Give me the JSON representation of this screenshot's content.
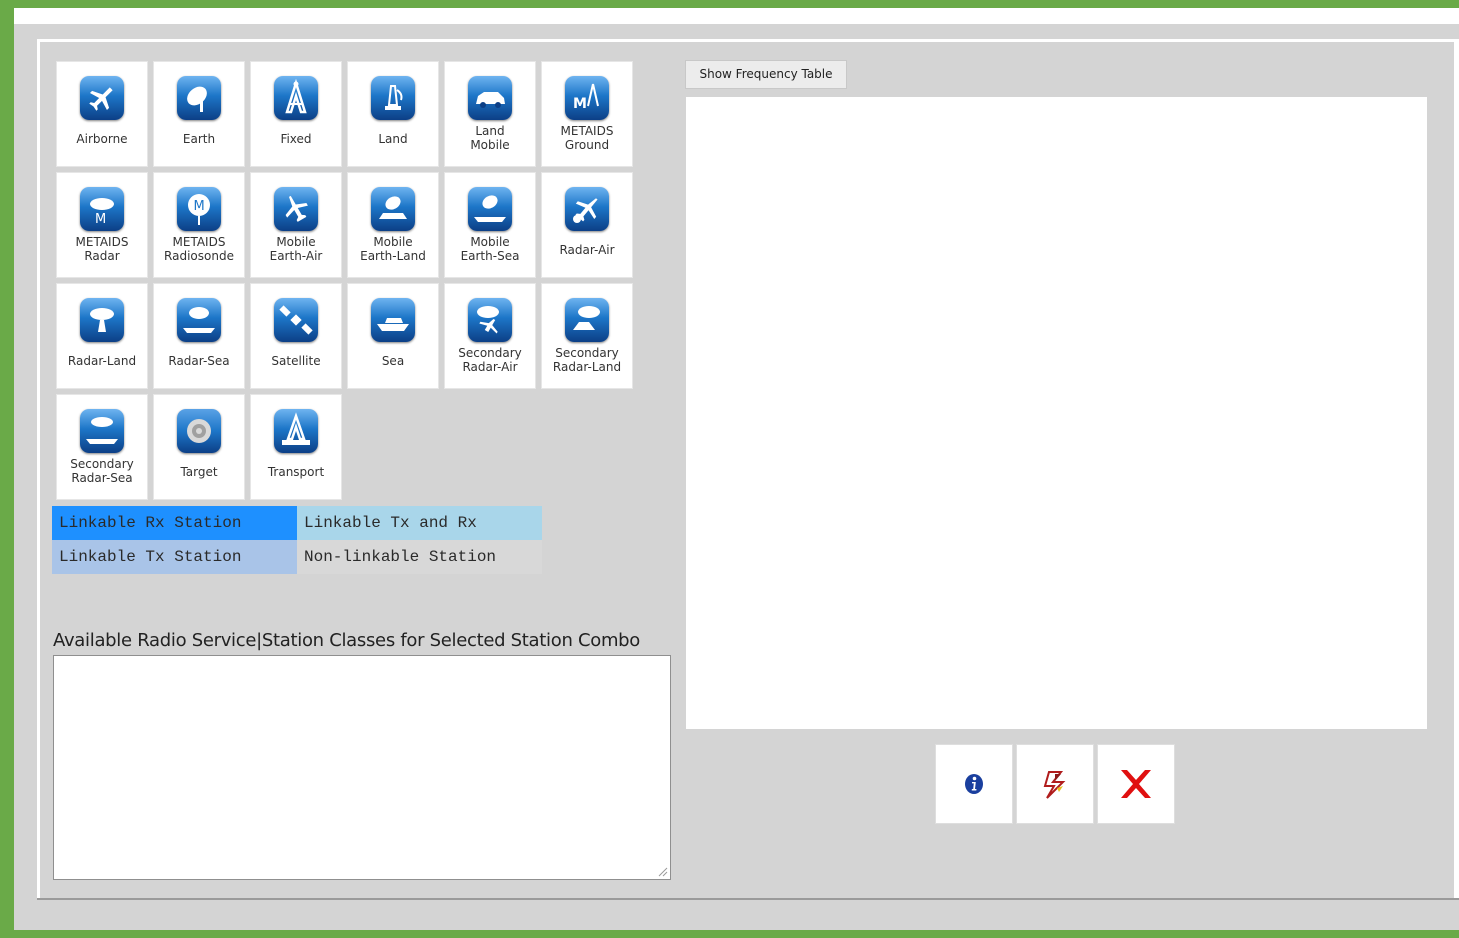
{
  "stations": [
    {
      "label": "Airborne",
      "icon": "airplane-icon"
    },
    {
      "label": "Earth",
      "icon": "satellite-dish-icon"
    },
    {
      "label": "Fixed",
      "icon": "fixed-tower-icon"
    },
    {
      "label": "Land",
      "icon": "land-antenna-icon"
    },
    {
      "label": "Land\nMobile",
      "icon": "car-icon"
    },
    {
      "label": "METAIDS\nGround",
      "icon": "metaids-ground-icon"
    },
    {
      "label": "METAIDS\nRadar",
      "icon": "metaids-radar-icon"
    },
    {
      "label": "METAIDS\nRadiosonde",
      "icon": "radiosonde-balloon-icon"
    },
    {
      "label": "Mobile\nEarth-Air",
      "icon": "mobile-earth-air-icon"
    },
    {
      "label": "Mobile\nEarth-Land",
      "icon": "mobile-earth-land-icon"
    },
    {
      "label": "Mobile\nEarth-Sea",
      "icon": "mobile-earth-sea-icon"
    },
    {
      "label": "Radar-Air",
      "icon": "radar-air-icon"
    },
    {
      "label": "Radar-Land",
      "icon": "radar-land-icon"
    },
    {
      "label": "Radar-Sea",
      "icon": "radar-sea-icon"
    },
    {
      "label": "Satellite",
      "icon": "satellite-icon"
    },
    {
      "label": "Sea",
      "icon": "ship-icon"
    },
    {
      "label": "Secondary\nRadar-Air",
      "icon": "secondary-radar-air-icon"
    },
    {
      "label": "Secondary\nRadar-Land",
      "icon": "secondary-radar-land-icon"
    },
    {
      "label": "Secondary\nRadar-Sea",
      "icon": "secondary-radar-sea-icon"
    },
    {
      "label": "Target",
      "icon": "target-icon"
    },
    {
      "label": "Transport",
      "icon": "transport-tower-icon"
    }
  ],
  "legend": {
    "rx": "Linkable Rx Station",
    "txrx": "Linkable Tx and Rx",
    "tx": "Linkable Tx Station",
    "non": "Non-linkable Station",
    "colors": {
      "rx": "#1e90ff",
      "txrx": "#a9d6ea",
      "tx": "#a9c4e8",
      "non": "#d8d8d8"
    }
  },
  "available_label": "Available Radio Service|Station Classes for Selected Station Combo",
  "available_value": "",
  "frequency_button": "Show Frequency Table",
  "actions": [
    {
      "icon": "info-icon",
      "color": "#1a3f9e"
    },
    {
      "icon": "link-lightning-icon",
      "color": "#b01c1c"
    },
    {
      "icon": "close-icon",
      "color": "#e01010"
    }
  ]
}
